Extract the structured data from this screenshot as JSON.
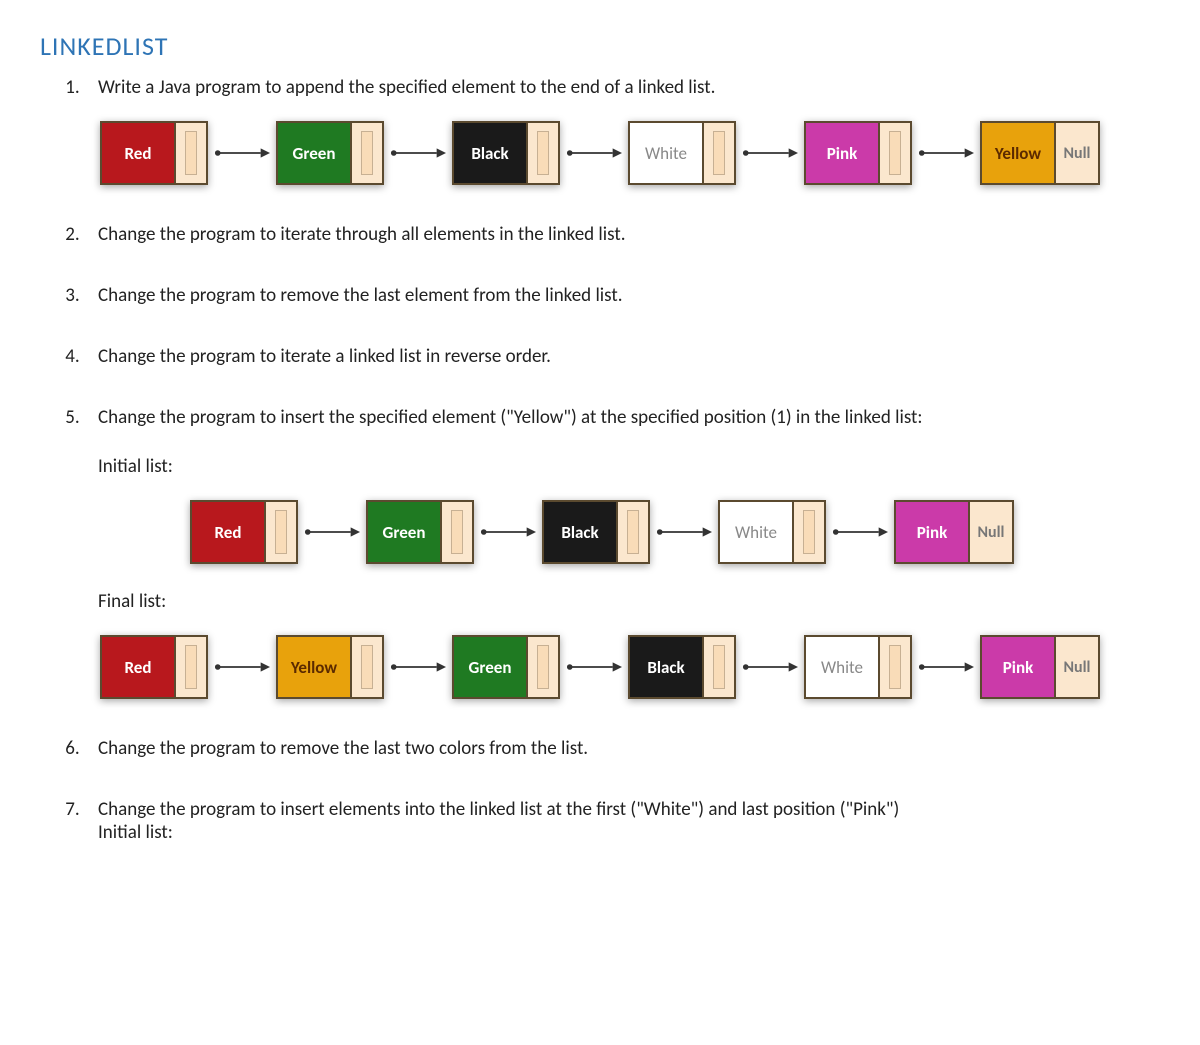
{
  "heading": "LINKEDLIST",
  "items": [
    {
      "text": "Write a Java program to append the specified element to the end of a linked list."
    },
    {
      "text": "Change the program to iterate through all elements in the linked list."
    },
    {
      "text": "Change the program to remove the last element from the linked list."
    },
    {
      "text": "Change the program to iterate a linked list in reverse order."
    },
    {
      "text": "Change the program to insert the specified element (\"Yellow\") at the specified position (1) in the linked list:"
    },
    {
      "text": "Change the program to remove the last two colors from the list."
    },
    {
      "text": "Change the program to insert elements into the linked list at the first (\"White\") and last position (\"Pink\")"
    }
  ],
  "labels": {
    "initial_list": "Initial list:",
    "final_list": "Final list:",
    "null": "Null"
  },
  "diagrams": {
    "d1": [
      {
        "label": "Red",
        "cls": "c-red"
      },
      {
        "label": "Green",
        "cls": "c-green"
      },
      {
        "label": "Black",
        "cls": "c-black"
      },
      {
        "label": "White",
        "cls": "c-white"
      },
      {
        "label": "Pink",
        "cls": "c-pink"
      },
      {
        "label": "Yellow",
        "cls": "c-yellow",
        "tail": true
      }
    ],
    "d5a": [
      {
        "label": "Red",
        "cls": "c-red"
      },
      {
        "label": "Green",
        "cls": "c-green"
      },
      {
        "label": "Black",
        "cls": "c-black"
      },
      {
        "label": "White",
        "cls": "c-white"
      },
      {
        "label": "Pink",
        "cls": "c-pink",
        "tail": true
      }
    ],
    "d5b": [
      {
        "label": "Red",
        "cls": "c-red"
      },
      {
        "label": "Yellow",
        "cls": "c-yellow"
      },
      {
        "label": "Green",
        "cls": "c-green"
      },
      {
        "label": "Black",
        "cls": "c-black"
      },
      {
        "label": "White",
        "cls": "c-white"
      },
      {
        "label": "Pink",
        "cls": "c-pink",
        "tail": true
      }
    ]
  }
}
